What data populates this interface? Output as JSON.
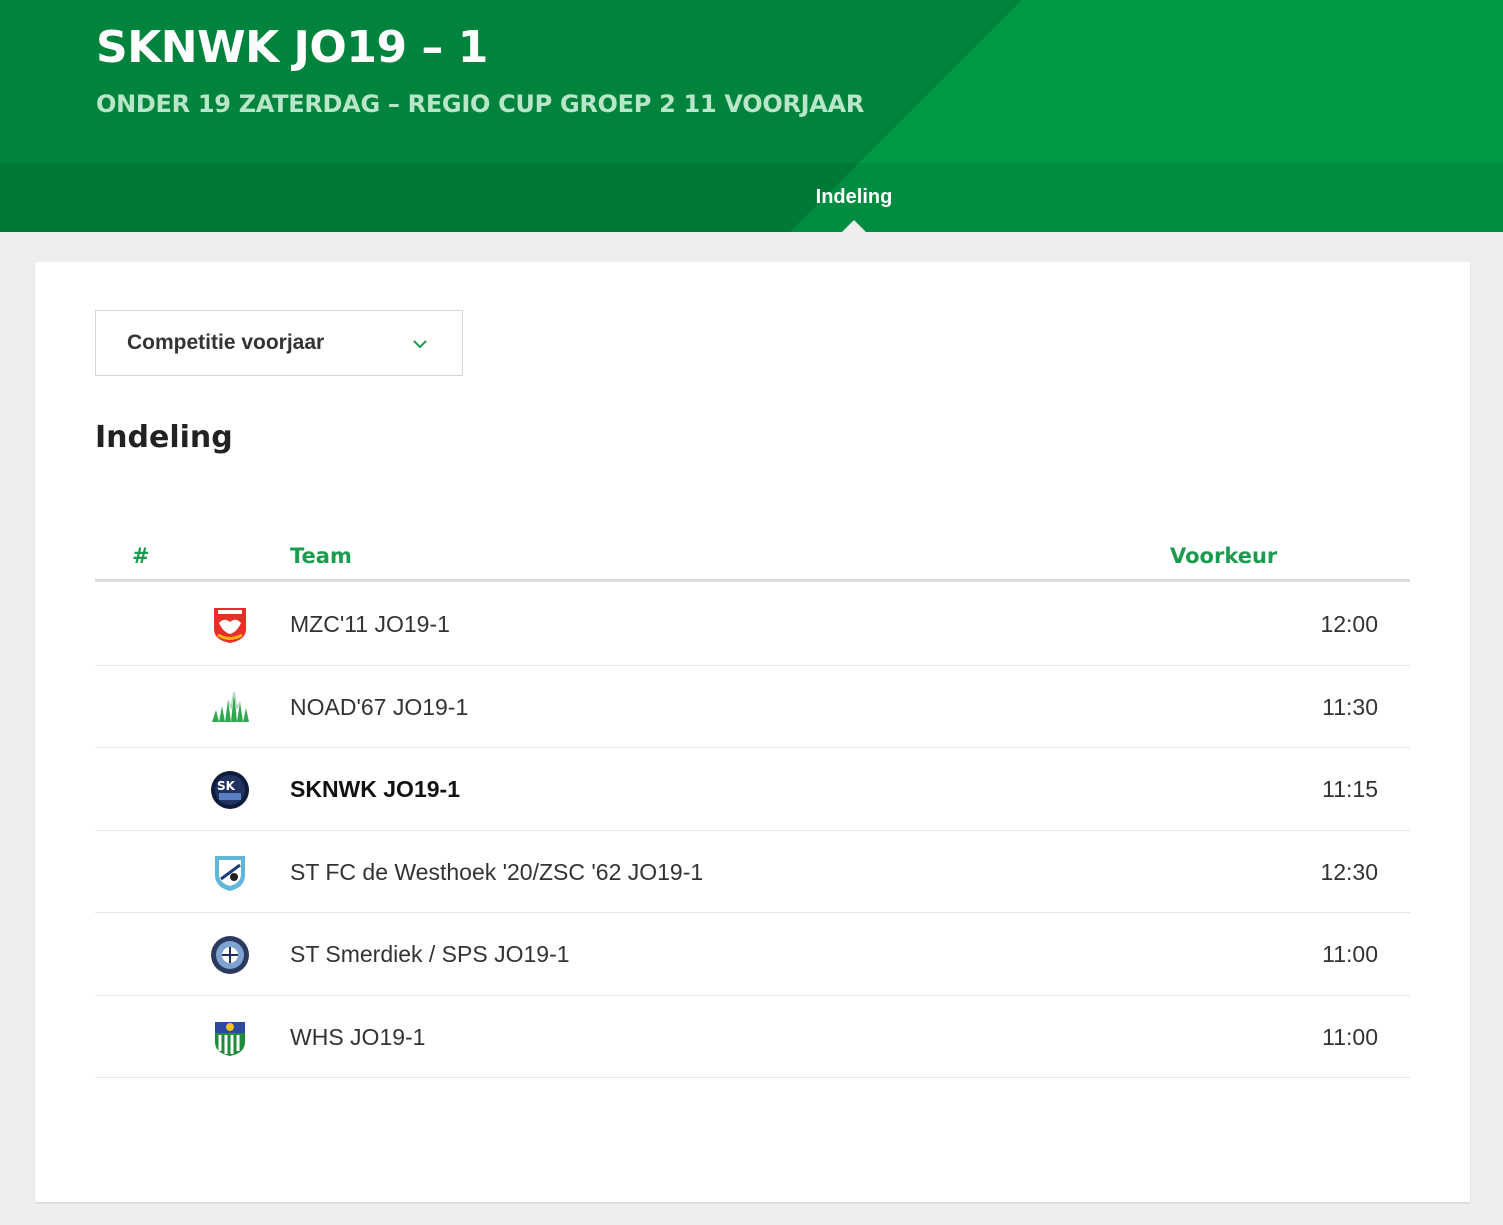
{
  "header": {
    "title": "SKNWK JO19 – 1",
    "subtitle": "ONDER 19 ZATERDAG – REGIO CUP GROEP 2 11 VOORJAAR",
    "tab_label": "Indeling"
  },
  "filter": {
    "selected": "Competitie voorjaar",
    "icon": "chevron-down-icon"
  },
  "section": {
    "title": "Indeling"
  },
  "table": {
    "columns": {
      "num": "#",
      "team": "Team",
      "preference": "Voorkeur"
    },
    "rows": [
      {
        "team": "MZC'11 JO19-1",
        "preference": "12:00",
        "logo": "mzc11-logo",
        "highlight": false
      },
      {
        "team": "NOAD'67 JO19-1",
        "preference": "11:30",
        "logo": "noad67-logo",
        "highlight": false
      },
      {
        "team": "SKNWK JO19-1",
        "preference": "11:15",
        "logo": "sknwk-logo",
        "highlight": true
      },
      {
        "team": "ST FC de Westhoek '20/ZSC '62 JO19-1",
        "preference": "12:30",
        "logo": "westhoek-logo",
        "highlight": false
      },
      {
        "team": "ST Smerdiek / SPS JO19-1",
        "preference": "11:00",
        "logo": "smerdiek-logo",
        "highlight": false
      },
      {
        "team": "WHS JO19-1",
        "preference": "11:00",
        "logo": "whs-logo",
        "highlight": false
      }
    ]
  },
  "colors": {
    "brand_green": "#00843d",
    "accent_green": "#1b9b4f",
    "light_green": "#00a04a"
  }
}
